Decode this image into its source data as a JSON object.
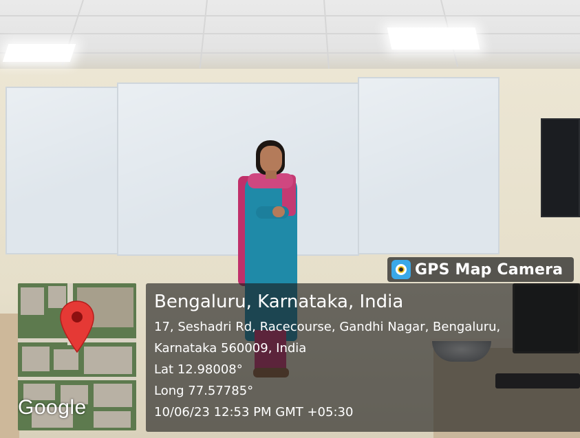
{
  "overlay": {
    "brand": {
      "icon": "gps-map-camera-app-icon",
      "name": "GPS Map Camera"
    },
    "map": {
      "pin_icon": "map-pin-icon",
      "pin_color": "#e53935",
      "provider_logo": "Google"
    },
    "location": {
      "title": "Bengaluru, Karnataka, India",
      "address_line_1": "17, Seshadri Rd, Racecourse, Gandhi Nagar, Bengaluru,",
      "address_line_2": "Karnataka 560009, India",
      "latitude": "Lat 12.98008°",
      "longitude": "Long 77.57785°",
      "timestamp": "10/06/23 12:53 PM GMT +05:30"
    }
  }
}
